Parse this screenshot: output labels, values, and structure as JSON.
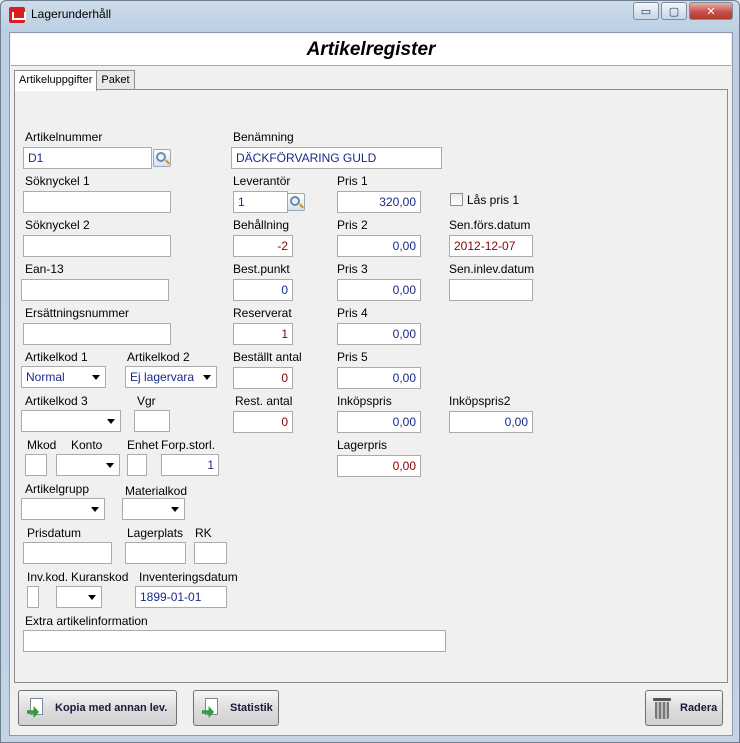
{
  "window": {
    "title": "Lagerunderhåll",
    "minimize": "▭",
    "maximize": "▢",
    "close": "✕"
  },
  "header": {
    "title": "Artikelregister"
  },
  "tabs": [
    {
      "label": "Artikeluppgifter",
      "active": true
    },
    {
      "label": "Paket",
      "active": false
    }
  ],
  "form": {
    "artikelnummer": {
      "label": "Artikelnummer",
      "value": "D1"
    },
    "benamning": {
      "label": "Benämning",
      "value": "DÄCKFÖRVARING GULD"
    },
    "soknyckel1": {
      "label": "Söknyckel 1",
      "value": ""
    },
    "leverantor": {
      "label": "Leverantör",
      "value": "1"
    },
    "pris1": {
      "label": "Pris 1",
      "value": "320,00"
    },
    "las_pris1": {
      "label": "Lås pris 1",
      "checked": false
    },
    "soknyckel2": {
      "label": "Söknyckel 2",
      "value": ""
    },
    "behallning": {
      "label": "Behållning",
      "value": "-2"
    },
    "pris2": {
      "label": "Pris 2",
      "value": "0,00"
    },
    "sen_fors_datum": {
      "label": "Sen.förs.datum",
      "value": "2012-12-07"
    },
    "ean13": {
      "label": "Ean-13",
      "value": ""
    },
    "best_punkt": {
      "label": "Best.punkt",
      "value": "0"
    },
    "pris3": {
      "label": "Pris 3",
      "value": "0,00"
    },
    "sen_inlev_datum": {
      "label": "Sen.inlev.datum",
      "value": ""
    },
    "ersattningsnummer": {
      "label": "Ersättningsnummer",
      "value": ""
    },
    "reserverat": {
      "label": "Reserverat",
      "value": "1"
    },
    "pris4": {
      "label": "Pris 4",
      "value": "0,00"
    },
    "artikelkod1": {
      "label": "Artikelkod 1",
      "value": "Normal"
    },
    "artikelkod2": {
      "label": "Artikelkod 2",
      "value": "Ej lagervara"
    },
    "bestallt_antal": {
      "label": "Beställt antal",
      "value": "0"
    },
    "pris5": {
      "label": "Pris 5",
      "value": "0,00"
    },
    "artikelkod3": {
      "label": "Artikelkod 3",
      "value": ""
    },
    "vgr": {
      "label": "Vgr",
      "value": ""
    },
    "rest_antal": {
      "label": "Rest. antal",
      "value": "0"
    },
    "inkopspris": {
      "label": "Inköpspris",
      "value": "0,00"
    },
    "inkopspris2": {
      "label": "Inköpspris2",
      "value": "0,00"
    },
    "mkod": {
      "label": "Mkod",
      "value": ""
    },
    "konto": {
      "label": "Konto",
      "value": ""
    },
    "enhet": {
      "label": "Enhet",
      "value": ""
    },
    "forp_storl": {
      "label": "Forp.storl.",
      "value": "1"
    },
    "lagerpris": {
      "label": "Lagerpris",
      "value": "0,00"
    },
    "artikelgrupp": {
      "label": "Artikelgrupp",
      "value": ""
    },
    "materialkod": {
      "label": "Materialkod",
      "value": ""
    },
    "prisdatum": {
      "label": "Prisdatum",
      "value": ""
    },
    "lagerplats": {
      "label": "Lagerplats",
      "value": ""
    },
    "rk": {
      "label": "RK",
      "value": ""
    },
    "inv_kod": {
      "label": "Inv.kod.",
      "value": ""
    },
    "kuranskod": {
      "label": "Kuranskod",
      "value": ""
    },
    "inventeringsdatum": {
      "label": "Inventeringsdatum",
      "value": "1899-01-01"
    },
    "extra_info": {
      "label": "Extra artikelinformation",
      "value": ""
    }
  },
  "buttons": {
    "kopia": "Kopia med annan lev.",
    "statistik": "Statistik",
    "radera": "Radera"
  }
}
